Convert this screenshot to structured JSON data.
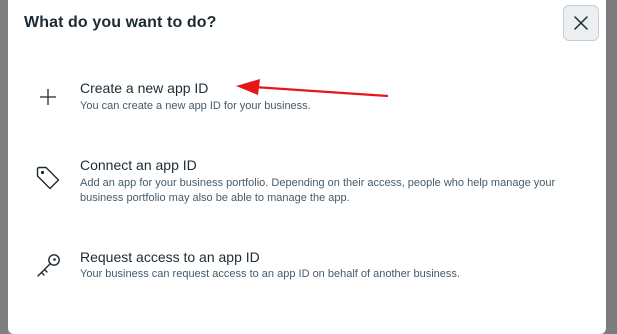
{
  "dialog": {
    "title": "What do you want to do?",
    "close_icon": "close-icon",
    "options": [
      {
        "title": "Create a new app ID",
        "description": "You can create a new app ID for your business.",
        "icon": "plus-icon"
      },
      {
        "title": "Connect an app ID",
        "description": "Add an app for your business portfolio. Depending on their access, people who help manage your business portfolio may also be able to manage the app.",
        "icon": "tag-icon"
      },
      {
        "title": "Request access to an app ID",
        "description": "Your business can request access to an app ID on behalf of another business.",
        "icon": "key-icon"
      }
    ]
  },
  "annotation": {
    "type": "arrow",
    "color": "#e8151b",
    "points_to": "Create a new app ID"
  }
}
